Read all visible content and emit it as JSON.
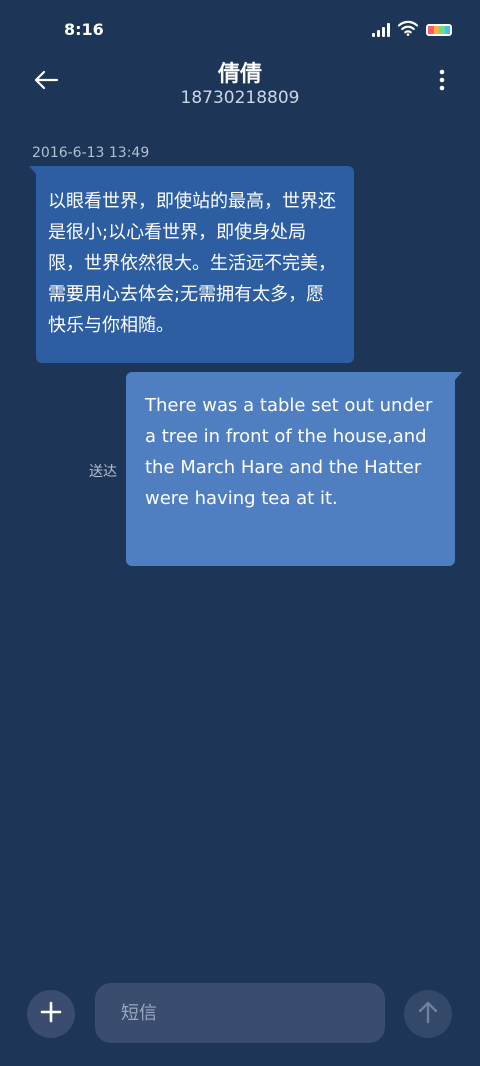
{
  "status_bar": {
    "time": "8:16",
    "icons": [
      "signal-icon",
      "wifi-icon",
      "battery-icon"
    ],
    "battery_colors": [
      "#ff5a6a",
      "#ffb23e",
      "#5be38f",
      "#4fb5ff"
    ]
  },
  "header": {
    "contact_name": "倩倩",
    "contact_number": "18730218809",
    "back_icon": "arrow-left-icon",
    "more_icon": "more-vertical-icon"
  },
  "conversation": {
    "timestamp": "2016-6-13 13:49",
    "incoming_message": "以眼看世界，即使站的最高，世界还是很小;以心看世界，即使身处局限，世界依然很大。生活远不完美，需要用心去体会;无需拥有太多，愿快乐与你相随。",
    "outgoing_message": "There was a table set out under a tree in front of the house,and the March Hare and the Hatter were having tea at it.",
    "delivery_status": "送达"
  },
  "composer": {
    "placeholder": "短信",
    "value": "",
    "add_icon": "plus-icon",
    "send_icon": "arrow-up-icon"
  },
  "colors": {
    "background": "#1d3557",
    "incoming_bubble": "#2d5ea2",
    "outgoing_bubble": "#4f7fc1",
    "input_background": "#3a4d6e"
  }
}
